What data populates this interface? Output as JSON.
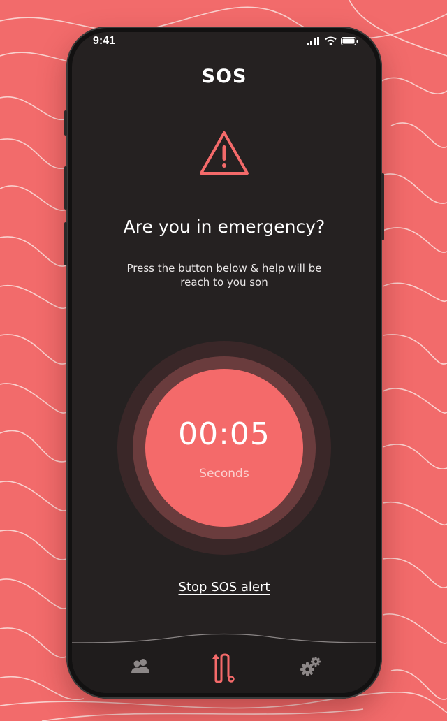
{
  "status_bar": {
    "time": "9:41"
  },
  "header": {
    "title": "SOS"
  },
  "alert": {
    "icon": "warning-icon",
    "heading": "Are you in emergency?",
    "description": "Press the button below & help will be reach to you son"
  },
  "countdown": {
    "time": "00:05",
    "unit_label": "Seconds"
  },
  "stop_link": {
    "label": "Stop SOS alert"
  },
  "tabbar": {
    "items": [
      {
        "icon": "contacts-icon",
        "active": false
      },
      {
        "icon": "sos-route-icon",
        "active": true
      },
      {
        "icon": "settings-icon",
        "active": false
      }
    ]
  },
  "colors": {
    "background": "#f26b6b",
    "screen": "#252121",
    "accent": "#f46a6a",
    "inactive_icon": "#8c8787"
  }
}
